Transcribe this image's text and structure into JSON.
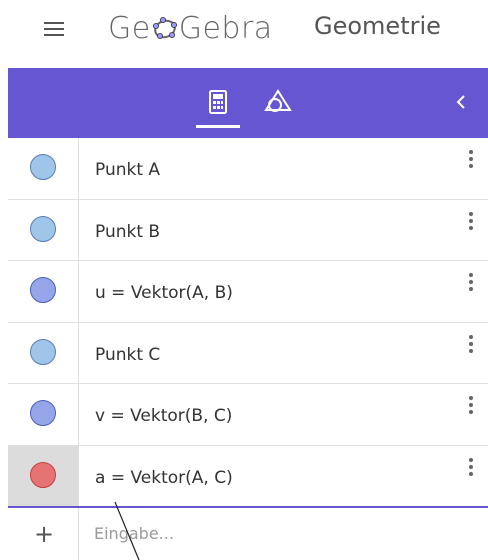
{
  "header": {
    "logo_part1": "Ge",
    "logo_part2": "Gebra",
    "app_name": "Geometrie",
    "logo_color": "#666666"
  },
  "toolbar": {
    "background": "#6557d2",
    "tabs": [
      {
        "name": "algebra",
        "icon": "calculator-icon",
        "active": true
      },
      {
        "name": "tools",
        "icon": "shapes-icon",
        "active": false
      }
    ],
    "collapse_icon": "chevron-left-icon"
  },
  "algebra": {
    "items": [
      {
        "label": "Punkt A",
        "marble_color": "#9fc5e8",
        "selected": false
      },
      {
        "label": "Punkt B",
        "marble_color": "#9fc5e8",
        "selected": false
      },
      {
        "label": "u = Vektor(A, B)",
        "marble_color": "#94a6e8",
        "selected": false
      },
      {
        "label": "Punkt C",
        "marble_color": "#9fc5e8",
        "selected": false
      },
      {
        "label": "v = Vektor(B, C)",
        "marble_color": "#94a6e8",
        "selected": false
      },
      {
        "label": "a = Vektor(A, C)",
        "marble_color": "#e57373",
        "selected": true
      }
    ],
    "input_placeholder": "Eingabe..."
  }
}
